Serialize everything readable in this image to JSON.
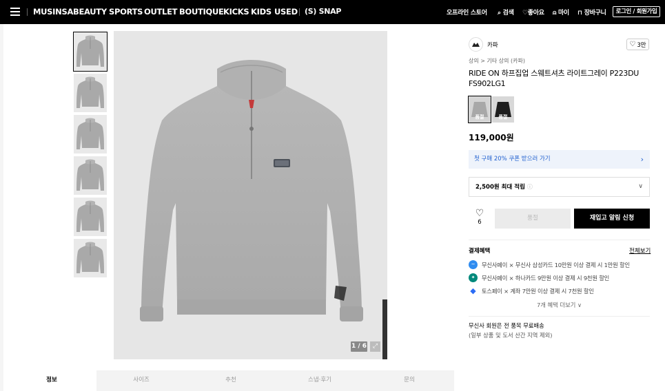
{
  "nav": {
    "items": [
      "MUSINSA",
      "BEAUTY",
      "SPORTS",
      "OUTLET",
      "BOUTIQUE",
      "KICKS",
      "KIDS",
      "USED"
    ],
    "snap": "(S) SNAP",
    "offline_store": "오프라인 스토어",
    "search": "검색",
    "like": "좋아요",
    "my": "마이",
    "cart": "장바구니",
    "login": "로그인 / 회원가입"
  },
  "gallery": {
    "counter": "1 / 6",
    "thumb_count": 6,
    "selected_index": 0
  },
  "product": {
    "brand": "카파",
    "likes": "3만",
    "breadcrumb": "상의 > 기타 상의 (카파)",
    "title_line1": "RIDE ON 하프집업 스웨트셔츠 라이트그레이 P223DU",
    "title_line2": "FS902LG1",
    "swatches": [
      {
        "label": "품절",
        "color": "#bdbdbd"
      },
      {
        "label": "품절",
        "color": "#1e1e1e"
      }
    ],
    "price": "119,000원",
    "coupon": "첫 구매 20% 쿠폰 받으러 가기",
    "points": "2,500원 최대 적립",
    "wish_count": "6",
    "soldout_label": "품절",
    "restock_label": "재입고 알림 신청"
  },
  "benefits": {
    "title": "결제혜택",
    "view_all": "전체보기",
    "items": [
      {
        "text": "무신사페이 × 무신사 삼성카드 10만원 이상 결제 시 1만원 할인",
        "color": "#2f8cf0"
      },
      {
        "text": "무신사페이 × 하나카드 9만원 이상 결제 시 9천원 할인",
        "color": "#00897b"
      },
      {
        "text": "토스페이 × 계좌 7만원 이상 결제 시 7천원 할인",
        "color": "#2b6cf5"
      }
    ],
    "more": "7개 혜택 더보기 ∨"
  },
  "shipping": {
    "line1": "무신사 회원은 전 품목 무료배송",
    "line2": "(일부 상품 및 도서 산간 지역 제외)"
  },
  "tabs": [
    "정보",
    "사이즈",
    "추천",
    "스냅·후기",
    "문의"
  ],
  "colors": {
    "accent": "#000000",
    "coupon_text": "#1f5fcf",
    "coupon_bg": "#eef3fb"
  }
}
